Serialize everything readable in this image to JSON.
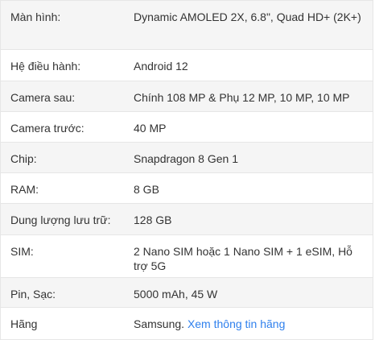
{
  "specs": [
    {
      "label": "Màn hình:",
      "value": "Dynamic AMOLED 2X, 6.8\", Quad HD+ (2K+)"
    },
    {
      "label": "Hệ điều hành:",
      "value": "Android 12"
    },
    {
      "label": "Camera sau:",
      "value": "Chính 108 MP & Phụ 12 MP, 10 MP, 10 MP"
    },
    {
      "label": "Camera trước:",
      "value": "40 MP"
    },
    {
      "label": "Chip:",
      "value": "Snapdragon 8 Gen 1"
    },
    {
      "label": "RAM:",
      "value": "8 GB"
    },
    {
      "label": "Dung lượng lưu trữ:",
      "value": "128 GB"
    },
    {
      "label": "SIM:",
      "value": "2 Nano SIM hoặc 1 Nano SIM + 1 eSIM, Hỗ trợ 5G"
    },
    {
      "label": "Pin, Sạc:",
      "value": "5000 mAh, 45 W"
    },
    {
      "label": "Hãng",
      "value": "Samsung.",
      "link": "Xem thông tin hãng"
    }
  ],
  "colors": {
    "link": "#2f80ed",
    "row_shade": "#f5f5f5",
    "border": "#e6e6e6",
    "text": "#333333"
  }
}
